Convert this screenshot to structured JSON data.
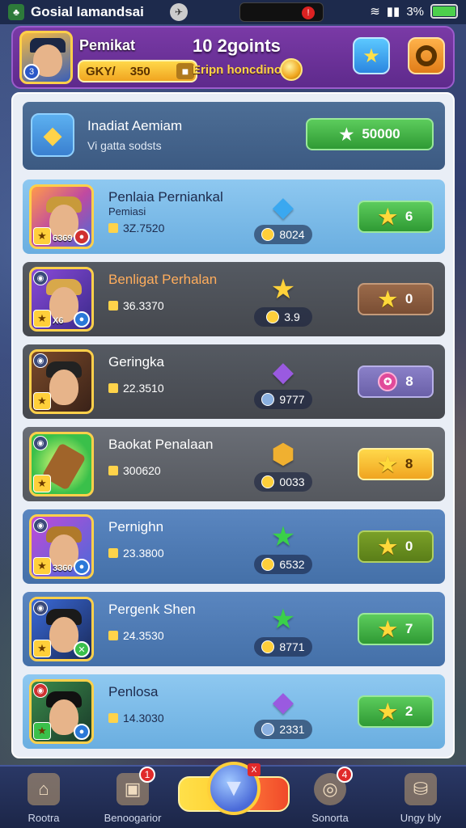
{
  "status_bar": {
    "app_name": "Gosial Iamandsai",
    "notification_count": "!",
    "battery": "3%"
  },
  "header": {
    "player_name": "Pemikat",
    "level_badge": "3",
    "coin_label": "GKY/",
    "coin_value": "350",
    "points_title": "10 2goints",
    "points_subtitle": "Eripn honcdino"
  },
  "top_row": {
    "title": "Inadiat Aemiam",
    "subtitle": "Vi gatta sodsts",
    "button_value": "50000"
  },
  "entries": [
    {
      "name": "Penlaia Perniankal",
      "sub": "Pemiasi",
      "meta": "3Z.7520",
      "gem_value": "8024",
      "gem_icon": "blue-gem",
      "rank": "6",
      "rank_style": "green",
      "portrait_score": "6369"
    },
    {
      "name": "Benligat Perhalan",
      "sub": "",
      "meta": "36.3370",
      "gem_value": "3.9",
      "gem_icon": "gold-star",
      "rank": "0",
      "rank_style": "brown",
      "portrait_score": "X6"
    },
    {
      "name": "Geringka",
      "sub": "",
      "meta": "22.3510",
      "gem_value": "9777",
      "gem_icon": "purple-gem",
      "rank": "8",
      "rank_style": "purple",
      "portrait_score": ""
    },
    {
      "name": "Baokat Penalaan",
      "sub": "",
      "meta": "300620",
      "gem_value": "0033",
      "gem_icon": "gold-badge",
      "rank": "8",
      "rank_style": "yellow",
      "portrait_score": ""
    },
    {
      "name": "Pernighn",
      "sub": "",
      "meta": "23.3800",
      "gem_value": "6532",
      "gem_icon": "green-star",
      "rank": "0",
      "rank_style": "olive",
      "portrait_score": "3360"
    },
    {
      "name": "Pergenk Shen",
      "sub": "",
      "meta": "24.3530",
      "gem_value": "8771",
      "gem_icon": "green-star",
      "rank": "7",
      "rank_style": "green",
      "portrait_score": ""
    },
    {
      "name": "Penlosa",
      "sub": "",
      "meta": "14.3030",
      "gem_value": "2331",
      "gem_icon": "purple-gem",
      "rank": "2",
      "rank_style": "green",
      "portrait_score": ""
    }
  ],
  "bottom_nav": {
    "items": [
      {
        "label": "Rootra",
        "icon": "home-icon",
        "badge": ""
      },
      {
        "label": "Benoogarior",
        "icon": "shop-icon",
        "badge": "1"
      },
      {
        "label": "Sonorta",
        "icon": "compass-icon",
        "badge": "4"
      },
      {
        "label": "Ungy bly",
        "icon": "bag-icon",
        "badge": ""
      }
    ],
    "center_badge": "X"
  }
}
